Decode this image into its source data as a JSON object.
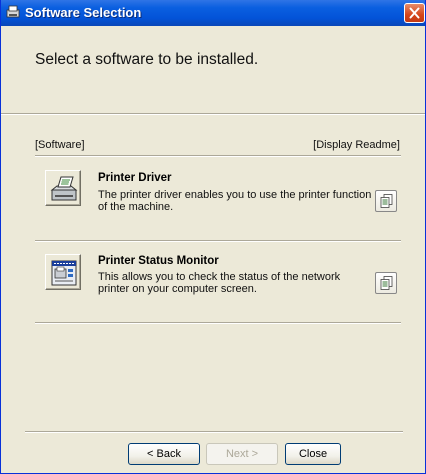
{
  "window": {
    "title": "Software Selection"
  },
  "heading": "Select a software to be installed.",
  "columns": {
    "left": "[Software]",
    "right": "[Display Readme]"
  },
  "items": [
    {
      "title": "Printer Driver",
      "description": "The printer driver enables you to use the printer function of the machine.",
      "icon": "printer-icon"
    },
    {
      "title": "Printer Status Monitor",
      "description": "This allows you to check the status of the network printer on your computer screen.",
      "icon": "status-monitor-icon"
    }
  ],
  "footer": {
    "back_label": "< Back",
    "next_label": "Next >",
    "close_label": "Close"
  },
  "colors": {
    "title_bar": "#0A5FE0",
    "window_bg": "#ECE9D8",
    "close_button": "#D5451B"
  }
}
